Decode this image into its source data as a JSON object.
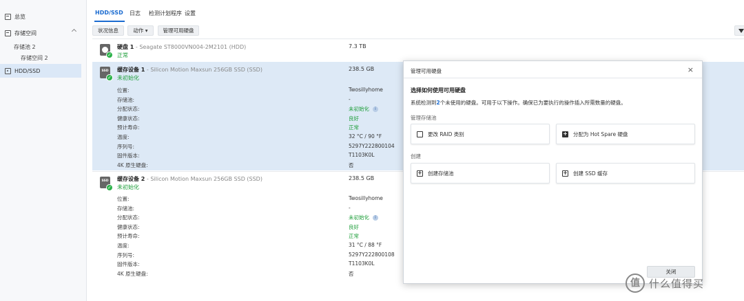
{
  "sidebar": {
    "overview": "总览",
    "storage": "存储空间",
    "pool": "存储池 2",
    "volume": "存储空间 2",
    "hdd_ssd": "HDD/SSD"
  },
  "tabs": [
    "HDD/SSD",
    "日志",
    "检测计划程序",
    "设置"
  ],
  "toolbar": {
    "status": "状况信息",
    "action": "动作 ▾",
    "manage": "管理可用硬盘"
  },
  "disks": [
    {
      "name": "硬盘 1",
      "model": " - Seagate ST8000VN004-2M2101 (HDD)",
      "status": "正常",
      "capacity": "7.3 TB"
    },
    {
      "name": "缓存设备 1",
      "model": " - Silicon Motion Maxsun 256GB SSD (SSD)",
      "status": "未初始化",
      "capacity": "238.5 GB",
      "details": [
        {
          "label": "位置:",
          "value": "Twosillyhome",
          "green": false
        },
        {
          "label": "存储池:",
          "value": "-",
          "green": false
        },
        {
          "label": "分配状态:",
          "value": "未初始化",
          "green": true,
          "info": true
        },
        {
          "label": "健康状态:",
          "value": "良好",
          "green": true
        },
        {
          "label": "预计寿命:",
          "value": "正常",
          "green": true
        },
        {
          "label": "温度:",
          "value": "32 °C / 90 °F",
          "green": false
        },
        {
          "label": "序列号:",
          "value": "5297Y222800104",
          "green": false
        },
        {
          "label": "固件版本:",
          "value": "T1103K0L",
          "green": false
        },
        {
          "label": "4K 原生硬盘:",
          "value": "否",
          "green": false
        }
      ]
    },
    {
      "name": "缓存设备 2",
      "model": " - Silicon Motion Maxsun 256GB SSD (SSD)",
      "status": "未初始化",
      "capacity": "238.5 GB",
      "details": [
        {
          "label": "位置:",
          "value": "Twosillyhome",
          "green": false
        },
        {
          "label": "存储池:",
          "value": "-",
          "green": false
        },
        {
          "label": "分配状态:",
          "value": "未初始化",
          "green": true,
          "info": true
        },
        {
          "label": "健康状态:",
          "value": "良好",
          "green": true
        },
        {
          "label": "预计寿命:",
          "value": "正常",
          "green": true
        },
        {
          "label": "温度:",
          "value": "31 °C / 88 °F",
          "green": false
        },
        {
          "label": "序列号:",
          "value": "5297Y222800108",
          "green": false
        },
        {
          "label": "固件版本:",
          "value": "T1103K0L",
          "green": false
        },
        {
          "label": "4K 原生硬盘:",
          "value": "否",
          "green": false
        }
      ]
    }
  ],
  "dialog": {
    "title": "管理可用硬盘",
    "heading": "选择如何使用可用硬盘",
    "desc_pre": "系统检测到",
    "desc_num": "2",
    "desc_post": "个未使用的硬盘。可用于以下操作。确保已为要执行的操作插入所需数量的硬盘。",
    "section1": "管理存储池",
    "opt_raid": "更改 RAID 类别",
    "opt_hotspare": "分配为 Hot Spare 硬盘",
    "section2": "创建",
    "opt_pool": "创建存储池",
    "opt_cache": "创建 SSD 缓存",
    "close": "关闭"
  },
  "icon_text": {
    "ssd": "SSD",
    "check": "✓",
    "info": "i",
    "close": "×",
    "plus": "+"
  },
  "watermark": {
    "badge": "值",
    "text": "什么值得买"
  },
  "colors": {
    "accent": "#1a6bd0",
    "ok_green": "#1e9e3a",
    "selected_row": "#dde9f6"
  }
}
